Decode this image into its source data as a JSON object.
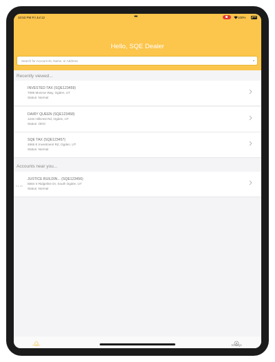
{
  "status_bar": {
    "time": "10:53 PM   Fri Jul 12",
    "dots": "•••",
    "battery": "100%"
  },
  "header": {
    "greeting": "Hello, SQE Dealer"
  },
  "search": {
    "placeholder": "Search for Account ID, Name, or Address"
  },
  "recently_viewed": {
    "title": "Recently viewed...",
    "items": [
      {
        "name": "INVESTED TAX (SQE123459)",
        "address": "7086 Monroe Way, Ogden, UT",
        "status": "Status: Normal"
      },
      {
        "name": "DAIRY QUEEN (SQE123458)",
        "address": "1234 Hillcrest Rd, Ogden, UT",
        "status": "Status: ODO"
      },
      {
        "name": "SQE TAX (SQE123457)",
        "address": "4965 E Investment Rd, Ogden, UT",
        "status": "Status: Normal"
      }
    ]
  },
  "accounts_near": {
    "title": "Accounts near you...",
    "items": [
      {
        "name": "JUSTICE BUILDIN... (SQE123456)",
        "address": "5684 S Ridgeline Dr, South Ogden, UT",
        "status": "Status: Normal",
        "side_tag": "0.1 mi"
      }
    ]
  },
  "tabbar": {
    "home_label": "Home",
    "settings_label": "Settings"
  },
  "colors": {
    "header": "#fcc54b",
    "home_tab": "#f7d27a",
    "background": "#f4f4f6"
  },
  "icons": {
    "home": "home-icon",
    "settings": "gear-icon",
    "chevron": "chevron-right-icon"
  }
}
